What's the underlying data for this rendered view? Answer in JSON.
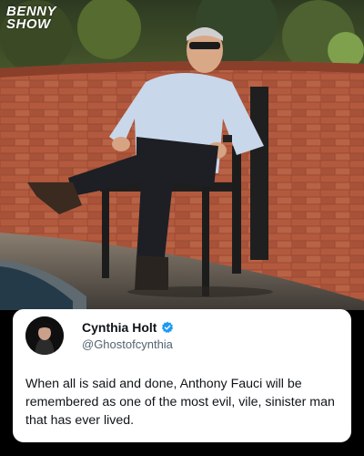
{
  "logo": {
    "line1": "BENNY",
    "line2": "SHOW"
  },
  "tweet": {
    "author_name": "Cynthia Holt",
    "author_handle": "@Ghostofcynthia",
    "text": "When all is said and done, Anthony Fauci will be remembered as one of the most evil, vile, sinister man that has ever lived."
  },
  "colors": {
    "card_background": "#ffffff",
    "verified_badge": "#1d9bf0",
    "handle_gray": "#536471"
  },
  "icons": [
    "verified-badge-icon"
  ]
}
